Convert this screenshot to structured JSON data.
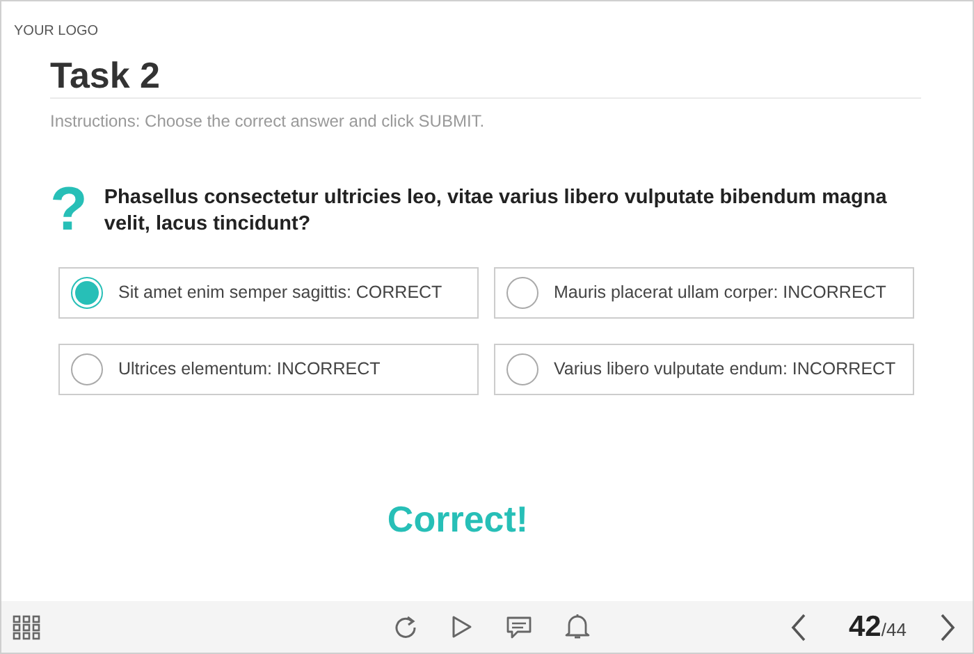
{
  "logo": "YOUR LOGO",
  "title": "Task 2",
  "instructions": "Instructions: Choose the correct answer and click SUBMIT.",
  "question": {
    "mark": "?",
    "text": "Phasellus consectetur ultricies leo, vitae varius libero vulputate bibendum magna velit, lacus tincidunt?"
  },
  "options": [
    {
      "label": "Sit amet enim semper sagittis: CORRECT",
      "selected": true
    },
    {
      "label": "Mauris placerat ullam corper: INCORRECT",
      "selected": false
    },
    {
      "label": "Ultrices elementum: INCORRECT",
      "selected": false
    },
    {
      "label": "Varius libero vulputate endum: INCORRECT",
      "selected": false
    }
  ],
  "feedback": "Correct!",
  "pager": {
    "current": "42",
    "total": "/44"
  }
}
